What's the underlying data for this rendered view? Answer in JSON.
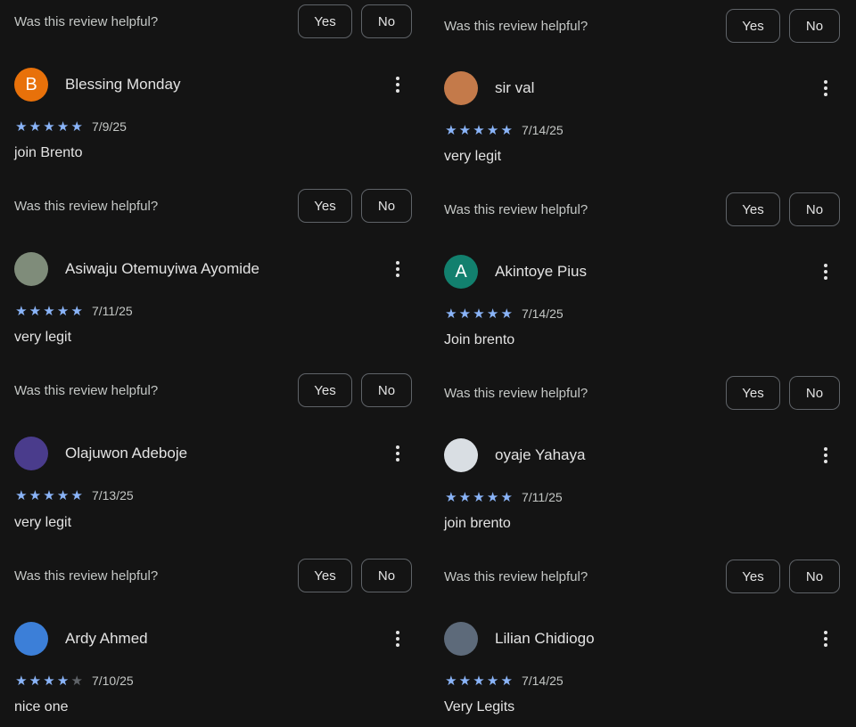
{
  "helpful_label": "Was this review helpful?",
  "yes_label": "Yes",
  "no_label": "No",
  "left": [
    {
      "author": "Blessing Monday",
      "initial": "B",
      "avatar_color": "#e8710a",
      "rating": 5,
      "date": "7/9/25",
      "text": "join Brento"
    },
    {
      "author": "Asiwaju Otemuyiwa Ayomide",
      "initial": "",
      "avatar_color": "#7f8c7a",
      "rating": 5,
      "date": "7/11/25",
      "text": "very legit"
    },
    {
      "author": "Olajuwon Adeboje",
      "initial": "",
      "avatar_color": "#4a3c8c",
      "rating": 5,
      "date": "7/13/25",
      "text": "very legit"
    },
    {
      "author": "Ardy Ahmed",
      "initial": "",
      "avatar_color": "#3c7fd8",
      "rating": 4,
      "date": "7/10/25",
      "text": "nice one"
    }
  ],
  "right": [
    {
      "author": "sir val",
      "initial": "",
      "avatar_color": "#c47a4a",
      "rating": 5,
      "date": "7/14/25",
      "text": "very legit"
    },
    {
      "author": "Akintoye Pius",
      "initial": "A",
      "avatar_color": "#12806e",
      "rating": 5,
      "date": "7/14/25",
      "text": "Join brento"
    },
    {
      "author": "oyaje Yahaya",
      "initial": "",
      "avatar_color": "#d9dee3",
      "rating": 5,
      "date": "7/11/25",
      "text": "join brento"
    },
    {
      "author": "Lilian Chidiogo",
      "initial": "",
      "avatar_color": "#5d6a7a",
      "rating": 5,
      "date": "7/14/25",
      "text": "Very Legits"
    }
  ]
}
